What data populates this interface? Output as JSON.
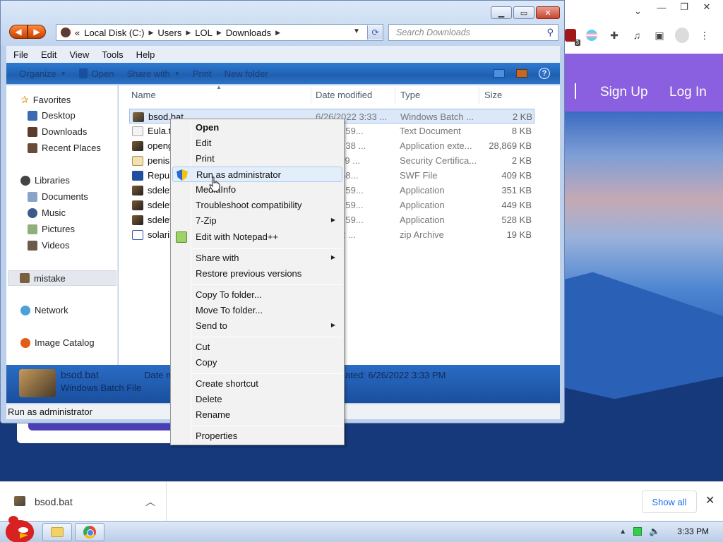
{
  "browser": {
    "site_links": [
      "Sign Up",
      "Log In"
    ],
    "extension_badge": "3"
  },
  "explorer": {
    "breadcrumbs": [
      "«",
      "Local Disk (C:)",
      "Users",
      "LOL",
      "Downloads"
    ],
    "search_placeholder": "Search Downloads",
    "menubar": [
      "File",
      "Edit",
      "View",
      "Tools",
      "Help"
    ],
    "toolbar": {
      "organize": "Organize",
      "open": "Open",
      "share_with": "Share with",
      "print": "Print",
      "new_folder": "New folder",
      "help": "?"
    },
    "nav_pane": {
      "favorites": "Favorites",
      "desktop": "Desktop",
      "downloads": "Downloads",
      "recent_places": "Recent Places",
      "libraries": "Libraries",
      "documents": "Documents",
      "music": "Music",
      "pictures": "Pictures",
      "videos": "Videos",
      "mistake": "mistake",
      "network": "Network",
      "image_catalog": "Image Catalog"
    },
    "columns": [
      "Name",
      "Date modified",
      "Type",
      "Size"
    ],
    "files": [
      {
        "name": "bsod.bat",
        "date": "6/26/2022 3:33 ...",
        "type": "Windows Batch ...",
        "size": "2 KB"
      },
      {
        "name": "Eula.tx",
        "date": "2020 8:59...",
        "type": "Text Document",
        "size": "8 KB"
      },
      {
        "name": "openg",
        "date": "2020 2:38 ...",
        "type": "Application exte...",
        "size": "28,869 KB"
      },
      {
        "name": "penis.",
        "date": "22 11:29 ...",
        "type": "Security Certifica...",
        "size": "2 KB"
      },
      {
        "name": "Repub",
        "date": "22 12:58...",
        "type": "SWF File",
        "size": "409 KB"
      },
      {
        "name": "sdelet",
        "date": "2020 8:59...",
        "type": "Application",
        "size": "351 KB"
      },
      {
        "name": "sdelet",
        "date": "2020 8:59...",
        "type": "Application",
        "size": "449 KB"
      },
      {
        "name": "sdelet",
        "date": "2020 8:59...",
        "type": "Application",
        "size": "528 KB"
      },
      {
        "name": "solaris",
        "date": "22 3:32 ...",
        "type": "zip Archive",
        "size": "19 KB"
      }
    ],
    "details": {
      "name": "bsod.bat",
      "type": "Windows Batch File",
      "date_label": "Date m",
      "created": "ated: 6/26/2022 3:33 PM"
    },
    "status": "Run as administrator"
  },
  "context_menu": {
    "open": "Open",
    "edit": "Edit",
    "print": "Print",
    "run_as_admin": "Run as administrator",
    "mediainfo": "MediaInfo",
    "troubleshoot": "Troubleshoot compatibility",
    "seven_zip": "7-Zip",
    "edit_npp": "Edit with Notepad++",
    "share_with": "Share with",
    "restore": "Restore previous versions",
    "copy_to": "Copy To folder...",
    "move_to": "Move To folder...",
    "send_to": "Send to",
    "cut": "Cut",
    "copy": "Copy",
    "create_shortcut": "Create shortcut",
    "delete": "Delete",
    "rename": "Rename",
    "properties": "Properties"
  },
  "download_shelf": {
    "file": "bsod.bat",
    "show_all": "Show all"
  },
  "taskbar": {
    "clock": "3:33 PM"
  }
}
